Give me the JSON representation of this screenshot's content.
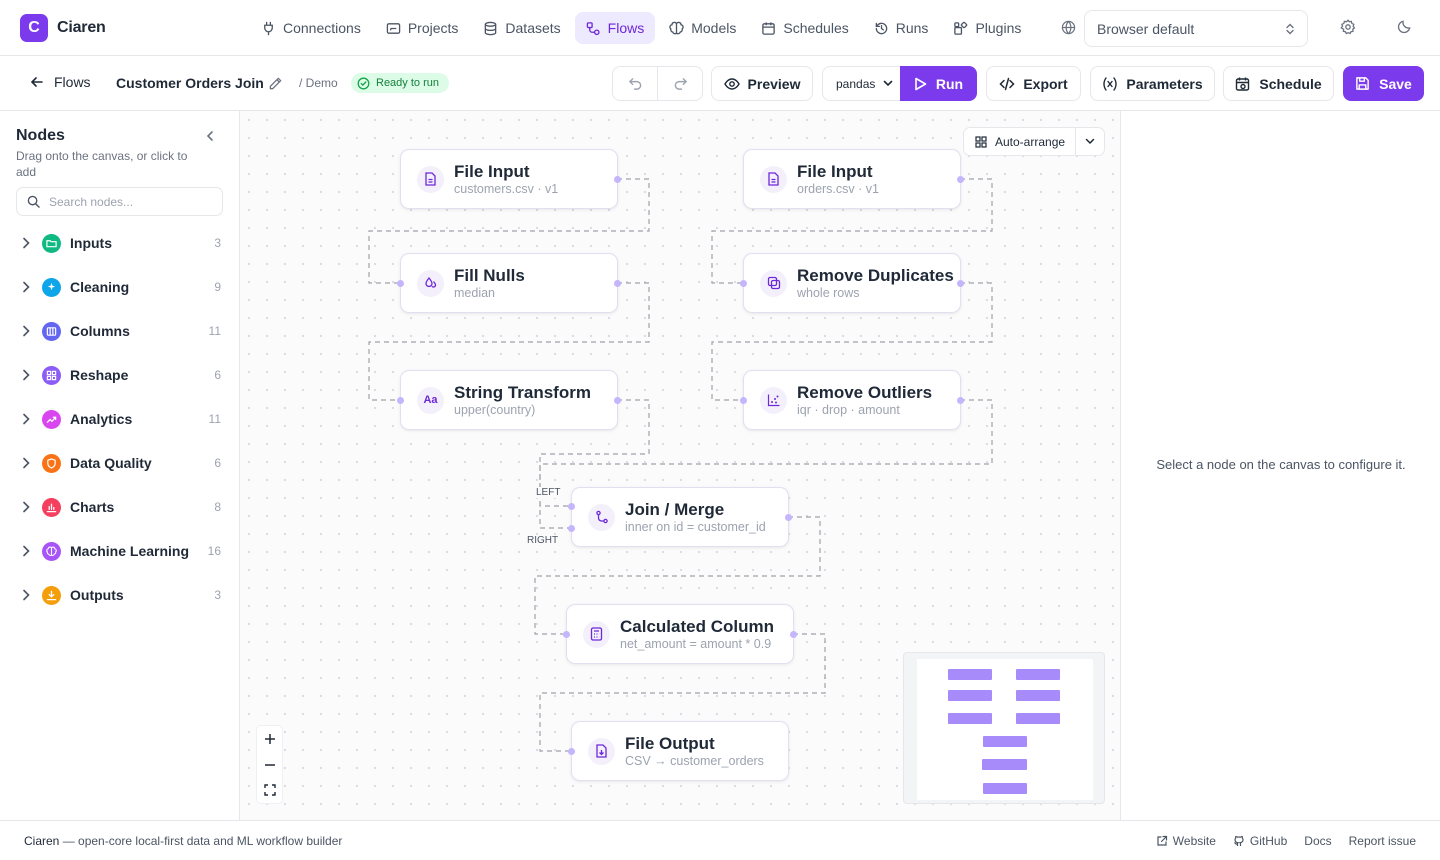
{
  "app": {
    "logo_letter": "C",
    "name": "Ciaren",
    "accent": "#7c3aed"
  },
  "nav": {
    "items": [
      {
        "label": "Connections",
        "icon": "plug-icon"
      },
      {
        "label": "Projects",
        "icon": "folder-icon"
      },
      {
        "label": "Datasets",
        "icon": "database-icon"
      },
      {
        "label": "Flows",
        "icon": "flow-icon",
        "active": true
      },
      {
        "label": "Models",
        "icon": "brain-icon"
      },
      {
        "label": "Schedules",
        "icon": "calendar-icon"
      },
      {
        "label": "Runs",
        "icon": "history-icon"
      },
      {
        "label": "Plugins",
        "icon": "puzzle-icon"
      }
    ],
    "language_select": "Browser default"
  },
  "toolbar": {
    "back_label": "Flows",
    "flow_name": "Customer Orders Join",
    "namespace": "/ Demo",
    "status": "Ready to run",
    "status_color": "#15803d",
    "preview_label": "Preview",
    "engine": "pandas",
    "run_label": "Run",
    "export_label": "Export",
    "parameters_label": "Parameters",
    "schedule_label": "Schedule",
    "save_label": "Save"
  },
  "sidebar": {
    "title": "Nodes",
    "hint": "Drag onto the canvas, or click to add",
    "search_placeholder": "Search nodes...",
    "categories": [
      {
        "label": "Inputs",
        "count": "3",
        "color": "#10b981",
        "icon": "folder-open-icon"
      },
      {
        "label": "Cleaning",
        "count": "9",
        "color": "#0ea5e9",
        "icon": "sparkles-icon"
      },
      {
        "label": "Columns",
        "count": "11",
        "color": "#6366f1",
        "icon": "columns-icon"
      },
      {
        "label": "Reshape",
        "count": "6",
        "color": "#8b5cf6",
        "icon": "grid-icon"
      },
      {
        "label": "Analytics",
        "count": "11",
        "color": "#d946ef",
        "icon": "trend-icon"
      },
      {
        "label": "Data Quality",
        "count": "6",
        "color": "#f97316",
        "icon": "shield-icon"
      },
      {
        "label": "Charts",
        "count": "8",
        "color": "#f43f5e",
        "icon": "bar-chart-icon"
      },
      {
        "label": "Machine Learning",
        "count": "16",
        "color": "#a855f7",
        "icon": "brain-icon"
      },
      {
        "label": "Outputs",
        "count": "3",
        "color": "#f59e0b",
        "icon": "download-icon"
      }
    ]
  },
  "canvas": {
    "auto_arrange_label": "Auto-arrange",
    "nodes": [
      {
        "id": "file_input_customers",
        "title": "File Input",
        "subtitle": "customers.csv · v1",
        "icon": "file-icon"
      },
      {
        "id": "fill_nulls",
        "title": "Fill Nulls",
        "subtitle": "median",
        "icon": "droplets-icon"
      },
      {
        "id": "string_transform",
        "title": "String Transform",
        "subtitle": "upper(country)",
        "icon": "text-case-icon"
      },
      {
        "id": "file_input_orders",
        "title": "File Input",
        "subtitle": "orders.csv · v1",
        "icon": "file-icon"
      },
      {
        "id": "remove_duplicates",
        "title": "Remove Duplicates",
        "subtitle": "whole rows",
        "icon": "copy-icon"
      },
      {
        "id": "remove_outliers",
        "title": "Remove Outliers",
        "subtitle": "iqr · drop · amount",
        "icon": "scatter-icon"
      },
      {
        "id": "join_merge",
        "title": "Join / Merge",
        "subtitle": "inner on id = customer_id",
        "icon": "merge-icon"
      },
      {
        "id": "calculated_column",
        "title": "Calculated Column",
        "subtitle": "net_amount = amount * 0.9",
        "icon": "calculator-icon"
      },
      {
        "id": "file_output",
        "title": "File Output",
        "subtitle": "CSV → customer_orders",
        "icon": "file-output-icon"
      }
    ],
    "join_ports": {
      "left": "LEFT",
      "right": "RIGHT"
    }
  },
  "config_panel": {
    "empty_message": "Select a node on the canvas to configure it."
  },
  "footer": {
    "brand": "Ciaren",
    "tagline": " — open-core local-first data and ML workflow builder",
    "links": [
      "Website",
      "GitHub",
      "Docs",
      "Report issue"
    ]
  }
}
